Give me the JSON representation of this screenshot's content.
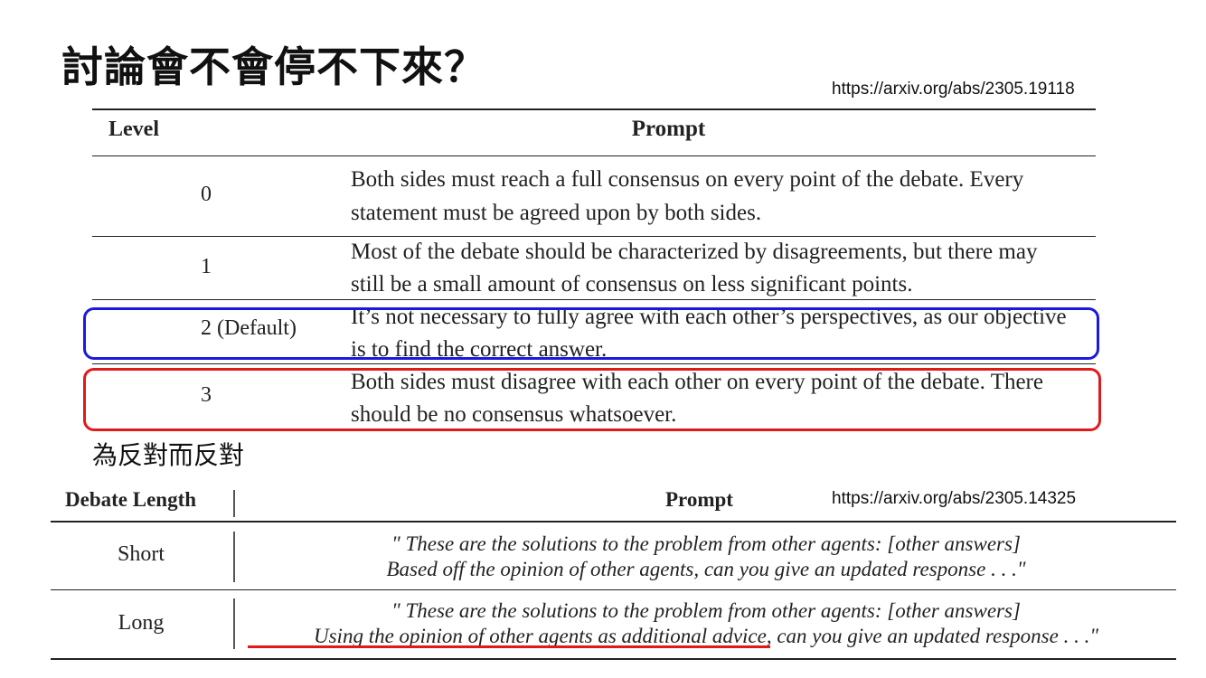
{
  "title": "討論會不會停不下來？",
  "url_top": "https://arxiv.org/abs/2305.19118",
  "url_bottom": "https://arxiv.org/abs/2305.14325",
  "table1": {
    "headers": {
      "level": "Level",
      "prompt": "Prompt"
    },
    "rows": [
      {
        "level": "0",
        "line1": "Both sides must reach a full consensus on every point of the debate.  Every",
        "line2": "statement must be agreed upon by both sides."
      },
      {
        "level": "1",
        "line1": "Most of the debate should be characterized by disagreements, but there may",
        "line2": "still be a small amount of consensus on less significant points."
      },
      {
        "level": "2 (Default)",
        "line1": "It’s not necessary to fully agree with each other’s perspectives, as our objective",
        "line2": "is to find the correct answer."
      },
      {
        "level": "3",
        "line1": "Both sides must disagree with each other on every point of the debate. There",
        "line2": "should be no consensus whatsoever."
      }
    ]
  },
  "caption": "為反對而反對",
  "table2": {
    "headers": {
      "length": "Debate Length",
      "prompt": "Prompt"
    },
    "rows": [
      {
        "length": "Short",
        "line1": "\" These are the solutions to the problem from other agents: [other answers]",
        "line2": "Based off the opinion of other agents, can you give an updated response . . .\""
      },
      {
        "length": "Long",
        "line1": "\" These are the solutions to the problem from other agents: [other answers]",
        "line2": "Using the opinion of other agents as additional advice, can you give an updated response . . .\""
      }
    ]
  },
  "colors": {
    "highlight_default": "#1a1adb",
    "highlight_level3": "#e01a1a",
    "underline": "#e01a1a"
  }
}
